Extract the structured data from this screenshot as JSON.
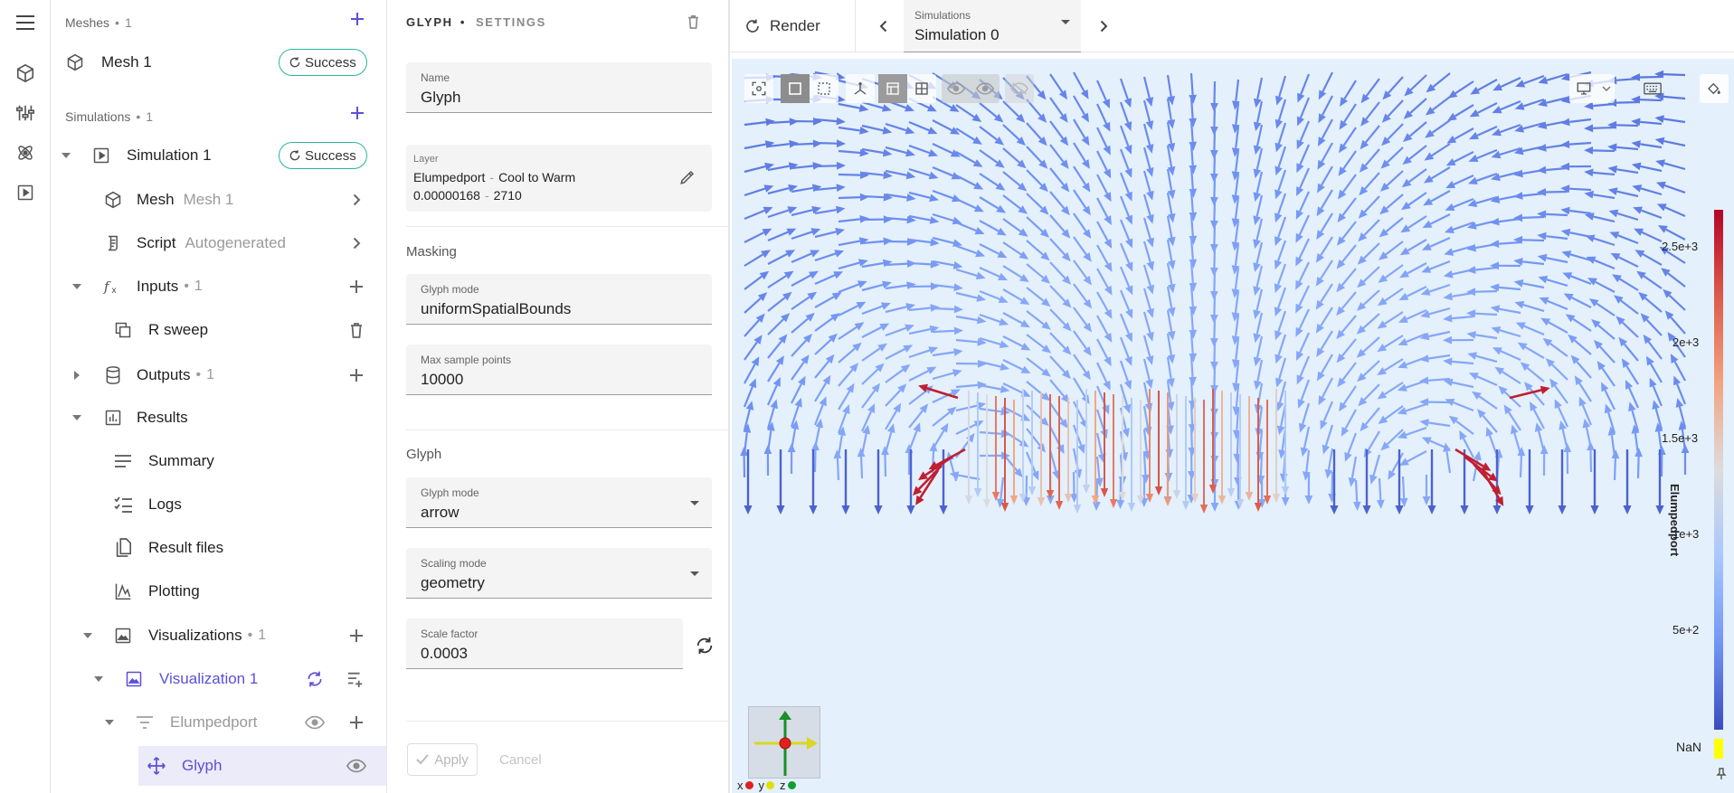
{
  "rail": {
    "icons": [
      "menu-icon",
      "mesh-cube-icon",
      "tune-sliders-icon",
      "atom-icon",
      "play-box-icon"
    ]
  },
  "tree": {
    "meshes": {
      "title": "Meshes",
      "count": "1"
    },
    "mesh1": {
      "label": "Mesh 1",
      "status": "Success"
    },
    "simulations": {
      "title": "Simulations",
      "count": "1"
    },
    "sim1": {
      "label": "Simulation 1",
      "status": "Success"
    },
    "mesh": {
      "label": "Mesh",
      "sub": "Mesh 1"
    },
    "script": {
      "label": "Script",
      "sub": "Autogenerated"
    },
    "inputs": {
      "label": "Inputs",
      "count": "1"
    },
    "rsweep": {
      "label": "R sweep"
    },
    "outputs": {
      "label": "Outputs",
      "count": "1"
    },
    "results": {
      "label": "Results"
    },
    "summary": {
      "label": "Summary"
    },
    "logs": {
      "label": "Logs"
    },
    "resultfiles": {
      "label": "Result files"
    },
    "plotting": {
      "label": "Plotting"
    },
    "visualizations": {
      "label": "Visualizations",
      "count": "1"
    },
    "vis1": {
      "label": "Visualization 1"
    },
    "elumpedport": {
      "label": "Elumpedport"
    },
    "glyph": {
      "label": "Glyph"
    },
    "sep": "•"
  },
  "settings": {
    "title_main": "GLYPH",
    "title_dot": "•",
    "title_sub": "SETTINGS",
    "name": {
      "label": "Name",
      "value": "Glyph"
    },
    "layer": {
      "label": "Layer",
      "field": "Elumpedport",
      "colormap": "Cool to Warm",
      "min": "0.00000168",
      "max": "2710",
      "sep": "-"
    },
    "masking": {
      "title": "Masking",
      "glyph_mode": {
        "label": "Glyph mode",
        "value": "uniformSpatialBounds"
      },
      "max_points": {
        "label": "Max sample points",
        "value": "10000"
      }
    },
    "glyph": {
      "title": "Glyph",
      "glyph_mode": {
        "label": "Glyph mode",
        "value": "arrow"
      },
      "scaling_mode": {
        "label": "Scaling mode",
        "value": "geometry"
      },
      "scale_factor": {
        "label": "Scale factor",
        "value": "0.0003"
      }
    },
    "apply": "Apply",
    "cancel": "Cancel"
  },
  "viewer": {
    "render": "Render",
    "sim_select": {
      "label": "Simulations",
      "value": "Simulation 0"
    },
    "colorbar": {
      "title": "Elumpedport",
      "ticks": [
        "2.5e+3",
        "2e+3",
        "1.5e+3",
        "1e+3",
        "5e+2"
      ],
      "nan": "NaN",
      "high_color": "#b40426",
      "low_color": "#3b4cc0",
      "nan_color": "#ffff00"
    },
    "axes": {
      "x": "x",
      "y": "y",
      "z": "z",
      "x_color": "#e02020",
      "y_color": "#e0e000",
      "z_color": "#10a030"
    }
  },
  "colors": {
    "accent": "#5b50d6",
    "success": "#2bb3a0"
  }
}
